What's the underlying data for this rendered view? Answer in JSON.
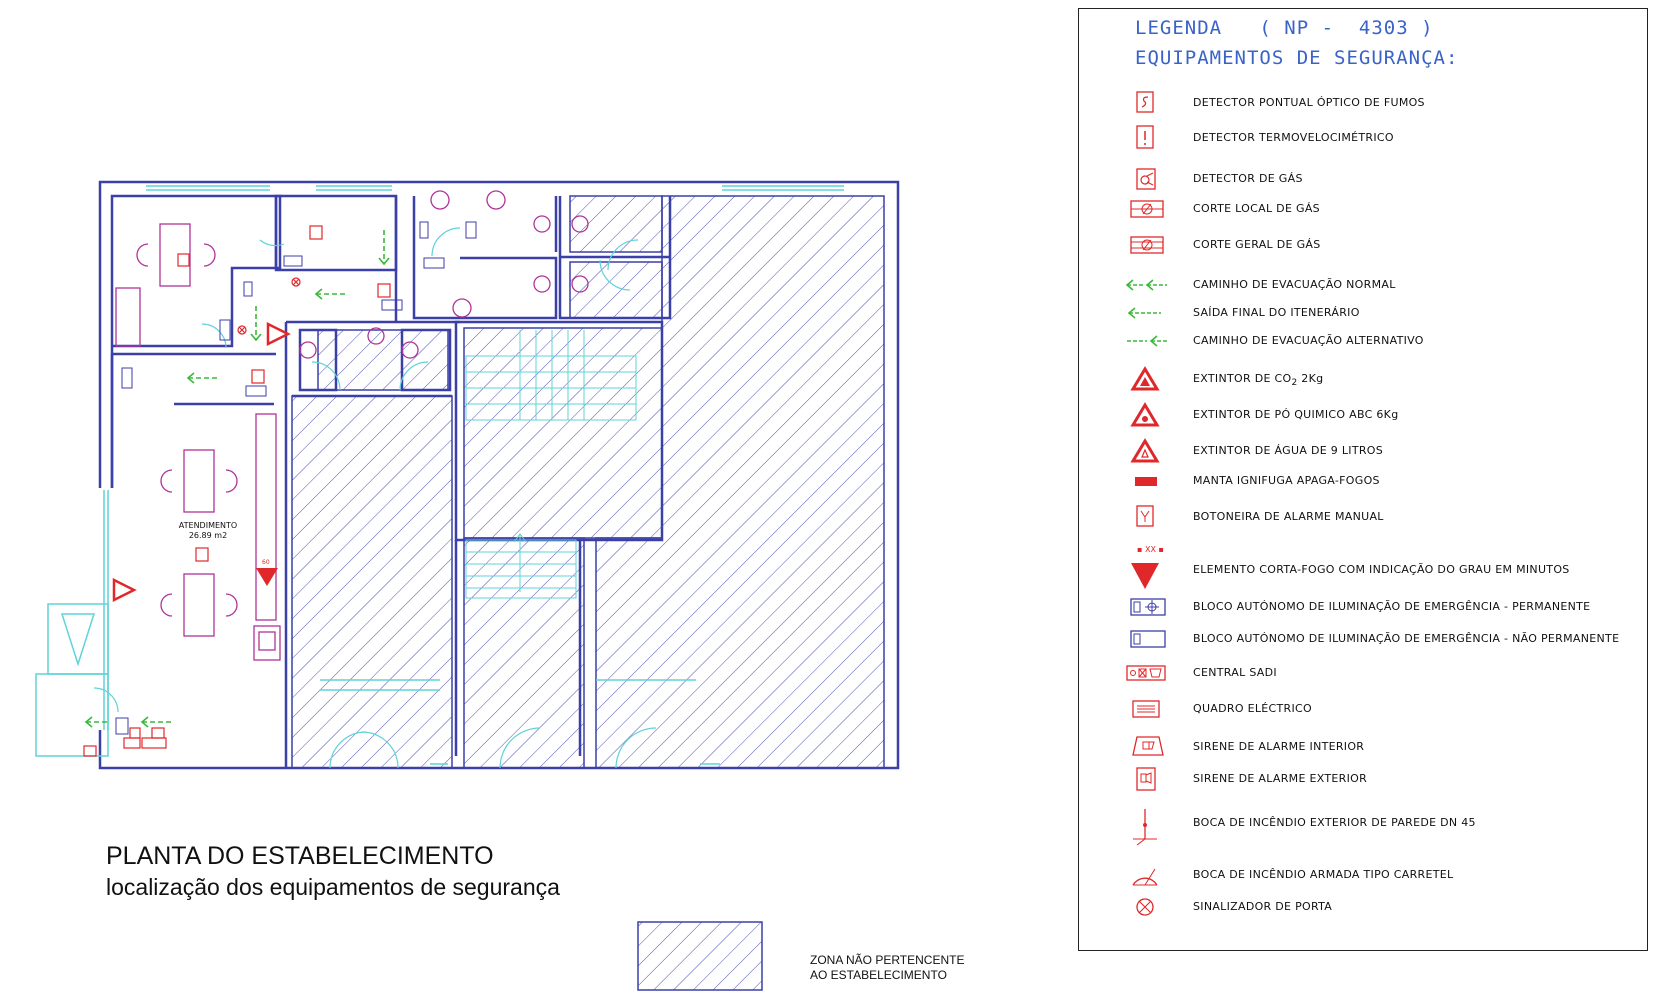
{
  "plan": {
    "title": "PLANTA DO ESTABELECIMENTO",
    "subtitle": "localização dos equipamentos de segurança",
    "room_label": "ATENDIMENTO",
    "room_area": "26.89 m2",
    "fire_rating": "60",
    "zone_label_line1": "ZONA NÃO PERTENCENTE",
    "zone_label_line2": "AO ESTABELECIMENTO"
  },
  "legend": {
    "header_line1": "LEGENDA   ( NP -  4303 )",
    "header_line2": "EQUIPAMENTOS DE SEGURANÇA:",
    "items": [
      {
        "symbol": "smoke-detector-icon",
        "label": "DETECTOR PONTUAL ÓPTICO DE FUMOS"
      },
      {
        "symbol": "heat-detector-icon",
        "label": "DETECTOR TERMOVELOCIMÉTRICO"
      },
      {
        "symbol": "gas-detector-icon",
        "label": "DETECTOR DE GÁS"
      },
      {
        "symbol": "local-gas-cutoff-icon",
        "label": "CORTE LOCAL DE GÁS"
      },
      {
        "symbol": "general-gas-cutoff-icon",
        "label": "CORTE GERAL DE GÁS"
      },
      {
        "symbol": "normal-evacuation-arrow-icon",
        "label": "CAMINHO DE EVACUAÇÃO NORMAL"
      },
      {
        "symbol": "final-exit-arrow-icon",
        "label": "SAÍDA FINAL DO ITENERÁRIO"
      },
      {
        "symbol": "alternative-evacuation-arrow-icon",
        "label": "CAMINHO DE EVACUAÇÃO ALTERNATIVO"
      },
      {
        "symbol": "co2-extinguisher-icon",
        "label": "EXTINTOR DE CO",
        "sub": "2",
        "suffix": "  2Kg"
      },
      {
        "symbol": "powder-extinguisher-icon",
        "label": "EXTINTOR DE PÓ QUIMICO  ABC 6Kg"
      },
      {
        "symbol": "water-extinguisher-icon",
        "label": "EXTINTOR DE ÁGUA DE 9 LITROS"
      },
      {
        "symbol": "fire-blanket-icon",
        "label": "MANTA IGNIFUGA APAGA-FOGOS"
      },
      {
        "symbol": "manual-alarm-button-icon",
        "label": "BOTONEIRA DE ALARME MANUAL"
      },
      {
        "symbol": "fire-door-element-icon",
        "label": "ELEMENTO CORTA-FOGO COM INDICAÇÃO DO GRAU EM MINUTOS",
        "mark": "XX"
      },
      {
        "symbol": "permanent-emergency-light-icon",
        "label": "BLOCO AUTÓNOMO DE ILUMINAÇÃO DE EMERGÊNCIA - PERMANENTE"
      },
      {
        "symbol": "non-permanent-emergency-light-icon",
        "label": "BLOCO AUTÓNOMO DE ILUMINAÇÃO DE EMERGÊNCIA - NÃO PERMANENTE"
      },
      {
        "symbol": "sadi-central-icon",
        "label": "CENTRAL  SADI"
      },
      {
        "symbol": "electrical-panel-icon",
        "label": "QUADRO ELÉCTRICO"
      },
      {
        "symbol": "interior-siren-icon",
        "label": "SIRENE DE ALARME INTERIOR"
      },
      {
        "symbol": "exterior-siren-icon",
        "label": "SIRENE DE ALARME EXTERIOR"
      },
      {
        "symbol": "exterior-hydrant-icon",
        "label": "BOCA DE INCÊNDIO EXTERIOR DE PAREDE DN 45"
      },
      {
        "symbol": "hose-reel-icon",
        "label": "BOCA DE INCÊNDIO ARMADA TIPO CARRETEL"
      },
      {
        "symbol": "door-signal-icon",
        "label": "SINALIZADOR DE PORTA"
      }
    ]
  },
  "colors": {
    "wall": "#3b3fa8",
    "cyan": "#5fd3d8",
    "safety_red": "#e0282a",
    "evacuation_green": "#3cb83c",
    "furniture_magenta": "#b0339a",
    "legend_header": "#3a63c8"
  }
}
